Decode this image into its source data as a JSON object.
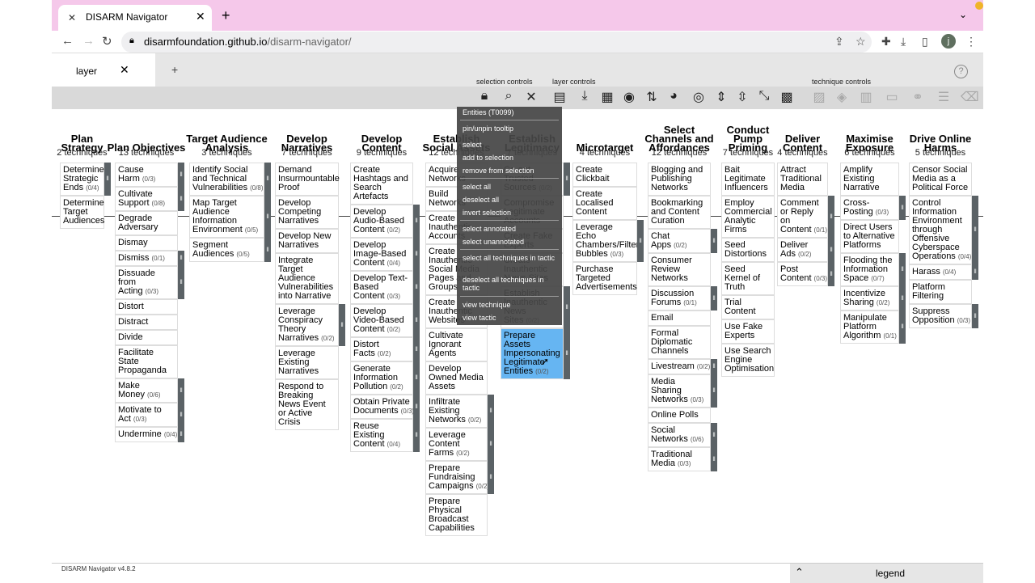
{
  "browser": {
    "tab_title": "DISARM Navigator",
    "close_glyph": "✕",
    "new_tab_glyph": "+",
    "tab_menu_glyph": "⌄",
    "url_domain": "disarmfoundation.github.io",
    "url_path": "/disarm-navigator/",
    "profile_initial": "j",
    "icons": [
      "back-icon",
      "forward-icon",
      "reload-icon",
      "lock-icon",
      "share-icon",
      "star-icon",
      "extensions-icon",
      "download-icon",
      "side-panel-icon",
      "menu-icon"
    ]
  },
  "app": {
    "layer_tab": "layer",
    "layer_close": "✕",
    "add_layer": "+",
    "help": "?",
    "toolbar": {
      "selection_controls": "selection controls",
      "layer_controls": "layer controls",
      "technique_controls": "technique controls"
    }
  },
  "tactics": [
    {
      "name": "Plan Strategy",
      "count": "2 techniques",
      "techniques": [
        {
          "name": "Determine Strategic Ends",
          "sub": "(0/4)",
          "bar": true
        },
        {
          "name": "Determine Target Audiences",
          "sub": "",
          "bar": false
        }
      ]
    },
    {
      "name": "Plan Objectives",
      "count": "13 techniques",
      "techniques": [
        {
          "name": "Cause Harm",
          "sub": "(0/3)",
          "bar": true
        },
        {
          "name": "Cultivate Support",
          "sub": "(0/8)",
          "bar": true
        },
        {
          "name": "Degrade Adversary",
          "sub": "",
          "bar": false
        },
        {
          "name": "Dismay",
          "sub": "",
          "bar": false
        },
        {
          "name": "Dismiss",
          "sub": "(0/1)",
          "bar": true
        },
        {
          "name": "Dissuade from Acting",
          "sub": "(0/3)",
          "bar": true
        },
        {
          "name": "Distort",
          "sub": "",
          "bar": false
        },
        {
          "name": "Distract",
          "sub": "",
          "bar": false
        },
        {
          "name": "Divide",
          "sub": "",
          "bar": false
        },
        {
          "name": "Facilitate State Propaganda",
          "sub": "",
          "bar": false
        },
        {
          "name": "Make Money",
          "sub": "(0/6)",
          "bar": true
        },
        {
          "name": "Motivate to Act",
          "sub": "(0/3)",
          "bar": true
        },
        {
          "name": "Undermine",
          "sub": "(0/4)",
          "bar": true
        }
      ]
    },
    {
      "name": "Target Audience Analysis",
      "count": "3 techniques",
      "techniques": [
        {
          "name": "Identify Social and Technical Vulnerabilities",
          "sub": "(0/8)",
          "bar": true
        },
        {
          "name": "Map Target Audience Information Environment",
          "sub": "(0/5)",
          "bar": true
        },
        {
          "name": "Segment Audiences",
          "sub": "(0/5)",
          "bar": true
        }
      ]
    },
    {
      "name": "Develop Narratives",
      "count": "7 techniques",
      "techniques": [
        {
          "name": "Demand Insurmountable Proof",
          "sub": "",
          "bar": false
        },
        {
          "name": "Develop Competing Narratives",
          "sub": "",
          "bar": false
        },
        {
          "name": "Develop New Narratives",
          "sub": "",
          "bar": false
        },
        {
          "name": "Integrate Target Audience Vulnerabilities into Narrative",
          "sub": "",
          "bar": false
        },
        {
          "name": "Leverage Conspiracy Theory Narratives",
          "sub": "(0/2)",
          "bar": true
        },
        {
          "name": "Leverage Existing Narratives",
          "sub": "",
          "bar": false
        },
        {
          "name": "Respond to Breaking News Event or Active Crisis",
          "sub": "",
          "bar": false
        }
      ]
    },
    {
      "name": "Develop Content",
      "count": "9 techniques",
      "techniques": [
        {
          "name": "Create Hashtags and Search Artefacts",
          "sub": "",
          "bar": false
        },
        {
          "name": "Develop Audio-Based Content",
          "sub": "(0/2)",
          "bar": true
        },
        {
          "name": "Develop Image-Based Content",
          "sub": "(0/4)",
          "bar": true
        },
        {
          "name": "Develop Text-Based Content",
          "sub": "(0/3)",
          "bar": true
        },
        {
          "name": "Develop Video-Based Content",
          "sub": "(0/2)",
          "bar": true
        },
        {
          "name": "Distort Facts",
          "sub": "(0/2)",
          "bar": true
        },
        {
          "name": "Generate Information Pollution",
          "sub": "(0/2)",
          "bar": true
        },
        {
          "name": "Obtain Private Documents",
          "sub": "(0/3)",
          "bar": true
        },
        {
          "name": "Reuse Existing Content",
          "sub": "(0/4)",
          "bar": true
        }
      ]
    },
    {
      "name": "Establish Social Assets",
      "count": "12 techniques",
      "techniques": [
        {
          "name": "Acquire Networks",
          "sub": "",
          "bar": false
        },
        {
          "name": "Build Networks",
          "sub": "",
          "bar": false
        },
        {
          "name": "Create Inauthentic Accounts",
          "sub": "",
          "bar": false
        },
        {
          "name": "Create Inauthentic Social Media Pages and Groups",
          "sub": "",
          "bar": false
        },
        {
          "name": "Create Inauthentic Websites",
          "sub": "",
          "bar": false
        },
        {
          "name": "Cultivate Ignorant Agents",
          "sub": "",
          "bar": false
        },
        {
          "name": "Develop Owned Media Assets",
          "sub": "",
          "bar": false
        },
        {
          "name": "Infiltrate Existing Networks",
          "sub": "(0/2)",
          "bar": true
        },
        {
          "name": "Leverage Content Farms",
          "sub": "(0/2)",
          "bar": true
        },
        {
          "name": "Prepare Fundraising Campaigns",
          "sub": "(0/2)",
          "bar": true
        },
        {
          "name": "Prepare Physical Broadcast Capabilities",
          "sub": "",
          "bar": false
        }
      ]
    },
    {
      "name": "Establish Legitimacy",
      "count": "7 techniques",
      "techniques": [
        {
          "name": "Co-opt Trusted Sources",
          "sub": "(0/2)",
          "bar": true
        },
        {
          "name": "Compromise Legitimate Accounts",
          "sub": "",
          "bar": false
        },
        {
          "name": "Create Fake Experts",
          "sub": "",
          "bar": false
        },
        {
          "name": "Create Inauthentic News Sites",
          "sub": "",
          "bar": false
        },
        {
          "name": "Establish Inauthentic News Sites",
          "sub": "(0/2)",
          "bar": true
        },
        {
          "name": "Prepare Assets Impersonating Legitimate Entities",
          "sub": "(0/2)",
          "bar": true,
          "selected": true
        }
      ]
    },
    {
      "name": "Microtarget",
      "count": "4 techniques",
      "techniques": [
        {
          "name": "Create Clickbait",
          "sub": "",
          "bar": false
        },
        {
          "name": "Create Localised Content",
          "sub": "",
          "bar": false
        },
        {
          "name": "Leverage Echo Chambers/Filter Bubbles",
          "sub": "(0/3)",
          "bar": true
        },
        {
          "name": "Purchase Targeted Advertisements",
          "sub": "",
          "bar": false
        }
      ]
    },
    {
      "name": "Select Channels and Affordances",
      "count": "12 techniques",
      "techniques": [
        {
          "name": "Blogging and Publishing Networks",
          "sub": "",
          "bar": false
        },
        {
          "name": "Bookmarking and Content Curation",
          "sub": "",
          "bar": false
        },
        {
          "name": "Chat Apps",
          "sub": "(0/2)",
          "bar": true
        },
        {
          "name": "Consumer Review Networks",
          "sub": "",
          "bar": false
        },
        {
          "name": "Discussion Forums",
          "sub": "(0/1)",
          "bar": true
        },
        {
          "name": "Email",
          "sub": "",
          "bar": false
        },
        {
          "name": "Formal Diplomatic Channels",
          "sub": "",
          "bar": false
        },
        {
          "name": "Livestream",
          "sub": "(0/2)",
          "bar": true
        },
        {
          "name": "Media Sharing Networks",
          "sub": "(0/3)",
          "bar": true
        },
        {
          "name": "Online Polls",
          "sub": "",
          "bar": false
        },
        {
          "name": "Social Networks",
          "sub": "(0/6)",
          "bar": true
        },
        {
          "name": "Traditional Media",
          "sub": "(0/3)",
          "bar": true
        }
      ]
    },
    {
      "name": "Conduct Pump Priming",
      "count": "7 techniques",
      "techniques": [
        {
          "name": "Bait Legitimate Influencers",
          "sub": "",
          "bar": false
        },
        {
          "name": "Employ Commercial Analytic Firms",
          "sub": "",
          "bar": false
        },
        {
          "name": "Seed Distortions",
          "sub": "",
          "bar": false
        },
        {
          "name": "Seed Kernel of Truth",
          "sub": "",
          "bar": false
        },
        {
          "name": "Trial Content",
          "sub": "",
          "bar": false
        },
        {
          "name": "Use Fake Experts",
          "sub": "",
          "bar": false
        },
        {
          "name": "Use Search Engine Optimisation",
          "sub": "",
          "bar": false
        }
      ]
    },
    {
      "name": "Deliver Content",
      "count": "4 techniques",
      "techniques": [
        {
          "name": "Attract Traditional Media",
          "sub": "",
          "bar": false
        },
        {
          "name": "Comment or Reply on Content",
          "sub": "(0/1)",
          "bar": true
        },
        {
          "name": "Deliver Ads",
          "sub": "(0/2)",
          "bar": true
        },
        {
          "name": "Post Content",
          "sub": "(0/3)",
          "bar": true
        }
      ]
    },
    {
      "name": "Maximise Exposure",
      "count": "6 techniques",
      "techniques": [
        {
          "name": "Amplify Existing Narrative",
          "sub": "",
          "bar": false
        },
        {
          "name": "Cross-Posting",
          "sub": "(0/3)",
          "bar": true
        },
        {
          "name": "Direct Users to Alternative Platforms",
          "sub": "",
          "bar": false
        },
        {
          "name": "Flooding the Information Space",
          "sub": "(0/7)",
          "bar": true
        },
        {
          "name": "Incentivize Sharing",
          "sub": "(0/2)",
          "bar": true
        },
        {
          "name": "Manipulate Platform Algorithm",
          "sub": "(0/1)",
          "bar": true
        }
      ]
    },
    {
      "name": "Drive Online Harms",
      "count": "5 techniques",
      "techniques": [
        {
          "name": "Censor Social Media as a Political Force",
          "sub": "",
          "bar": false
        },
        {
          "name": "Control Information Environment through Offensive Cyberspace Operations",
          "sub": "(0/4)",
          "bar": true
        },
        {
          "name": "Harass",
          "sub": "(0/4)",
          "bar": true
        },
        {
          "name": "Platform Filtering",
          "sub": "",
          "bar": false
        },
        {
          "name": "Suppress Opposition",
          "sub": "(0/3)",
          "bar": true
        }
      ]
    }
  ],
  "context_menu": {
    "items": [
      "Entities (T0099)",
      "pin/unpin tooltip",
      "select",
      "add to selection",
      "remove from selection",
      "select all",
      "deselect all",
      "invert selection",
      "select annotated",
      "select unannotated",
      "select all techniques in tactic",
      "deselect all techniques in tactic",
      "view technique",
      "view tactic"
    ]
  },
  "footer": {
    "version": "DISARM Navigator v4.8.2",
    "legend": "legend",
    "legend_chevron": "⌃"
  },
  "colors": {
    "selected_cell": "#66b5f2",
    "subtechnique_bar": "#5b6266",
    "browser_tab_strip": "#f5c8ea",
    "toolbar": "#d9d9d9",
    "context_menu": "#464646"
  }
}
